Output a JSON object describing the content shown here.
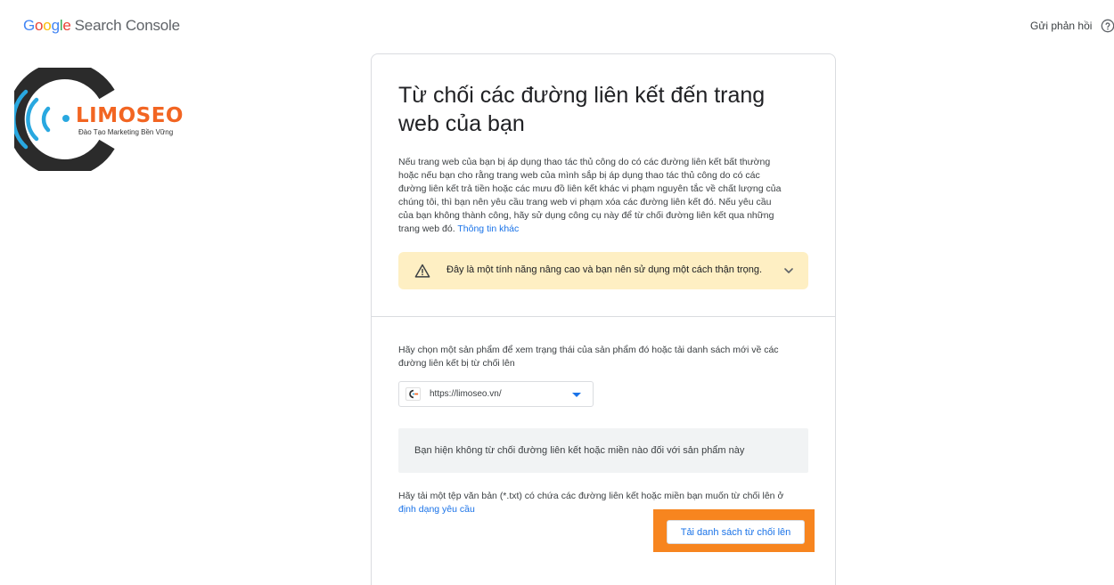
{
  "header": {
    "logo_letters": [
      "G",
      "o",
      "o",
      "g",
      "l",
      "e"
    ],
    "product_name": "Search Console",
    "feedback_label": "Gửi phản hồi",
    "help_icon": "help-circle-icon"
  },
  "watermark": {
    "brand": "LIMOSEO",
    "tagline": "Đào Tạo Marketing Bền Vững"
  },
  "card": {
    "title": "Từ chối các đường liên kết đến trang web của bạn",
    "intro_text": "Nếu trang web của bạn bị áp dụng thao tác thủ công do có các đường liên kết bất thường hoặc nếu bạn cho rằng trang web của mình sắp bị áp dụng thao tác thủ công do có các đường liên kết trả tiền hoặc các mưu đồ liên kết khác vi phạm nguyên tắc về chất lượng của chúng tôi, thì bạn nên yêu cầu trang web vi phạm xóa các đường liên kết đó. Nếu yêu cầu của bạn không thành công, hãy sử dụng công cụ này để từ chối đường liên kết qua những trang web đó.",
    "intro_link": "Thông tin khác",
    "warning": {
      "text": "Đây là một tính năng nâng cao và bạn nên sử dụng một cách thận trọng.",
      "icon": "warning-triangle-icon",
      "toggle_icon": "chevron-down-icon"
    },
    "choose_text": "Hãy chọn một sản phẩm để xem trạng thái của sản phẩm đó hoặc tải danh sách mới về các đường liên kết bị từ chối lên",
    "property_select": {
      "value": "https://limoseo.vn/",
      "icon": "site-favicon-icon"
    },
    "status_text": "Bạn hiện không từ chối đường liên kết hoặc miền nào đối với sản phẩm này",
    "upload_text": "Hãy tải một tệp văn bản (*.txt) có chứa các đường liên kết hoặc miền bạn muốn từ chối lên ở",
    "upload_link": "định dạng yêu cầu",
    "upload_button": "Tải danh sách từ chối lên"
  },
  "colors": {
    "google_blue": "#4285f4",
    "google_red": "#ea4335",
    "google_yellow": "#fbbc05",
    "google_green": "#34a853",
    "link": "#1a73e8",
    "warning_bg": "#feefc3",
    "highlight": "#f7851f",
    "watermark_brand": "#f26522"
  }
}
